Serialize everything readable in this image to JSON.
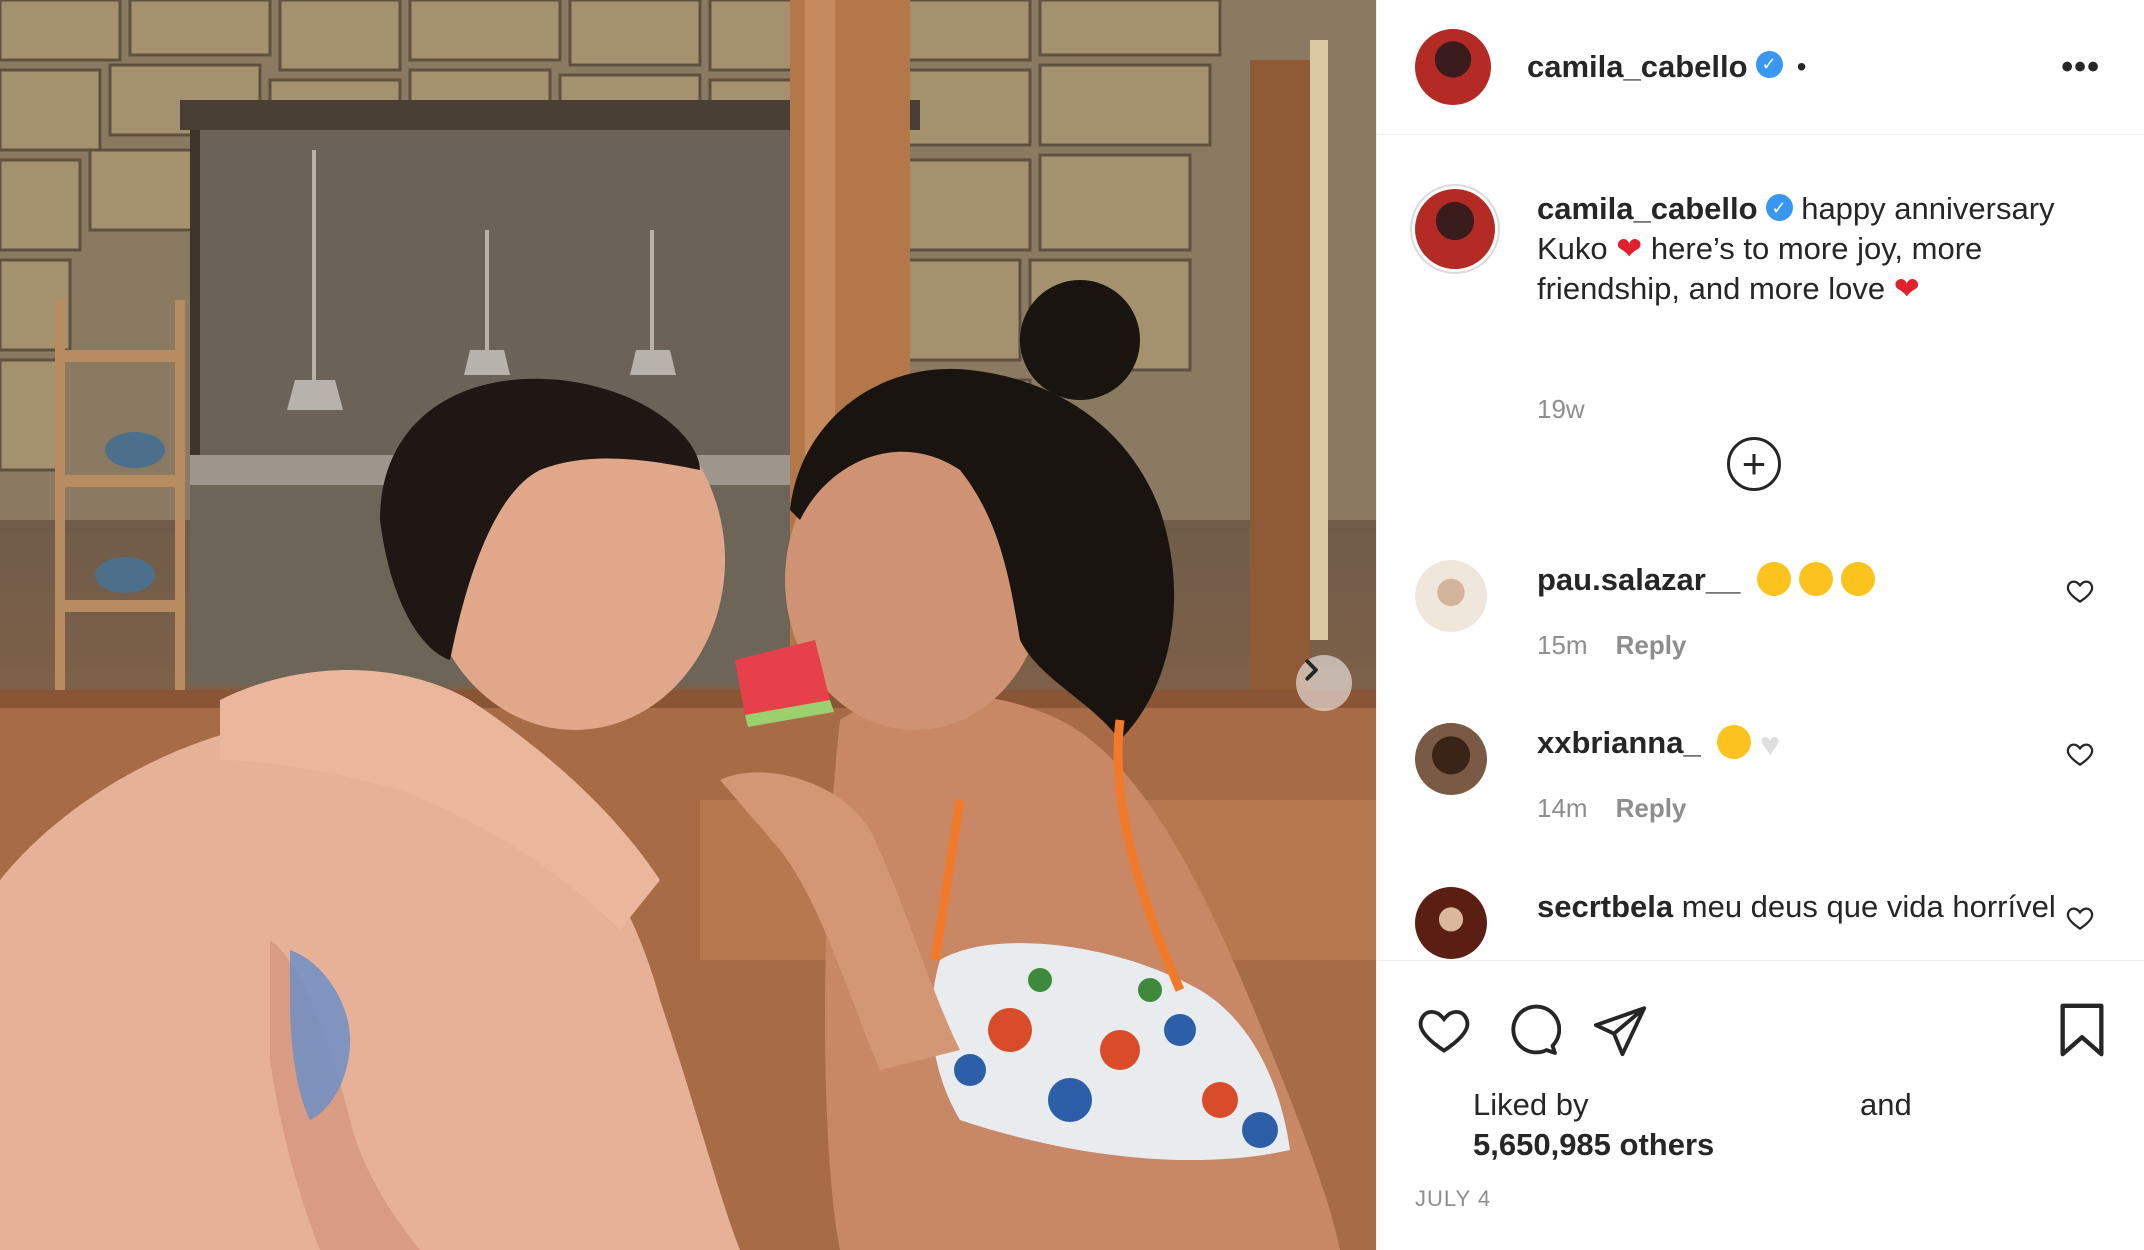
{
  "post": {
    "username": "camila_cabello",
    "header_separator": "•",
    "more_options": "•••"
  },
  "caption": {
    "username": "camila_cabello",
    "text_part1": "happy anniversary Kuko",
    "text_part2": "here’s to more joy, more friendship, and more love",
    "time": "19w"
  },
  "comments": [
    {
      "username": "pau.salazar__",
      "text": "",
      "emojis": [
        "😭",
        "😭",
        "😭"
      ],
      "time": "15m",
      "reply_label": "Reply"
    },
    {
      "username": "xxbrianna_",
      "text": "",
      "emojis": [
        "🥺",
        "🤍"
      ],
      "time": "14m",
      "reply_label": "Reply"
    },
    {
      "username": "secrtbela",
      "text": "meu deus que vida horrível",
      "time": "",
      "reply_label": ""
    }
  ],
  "likes": {
    "liked_by": "Liked by",
    "and": "and",
    "count_text": "5,650,985 others"
  },
  "date": "JULY 4",
  "icons": [
    "heart-icon",
    "comment-icon",
    "share-icon",
    "bookmark-icon",
    "plus-circle-icon",
    "more-options-icon",
    "verified-badge-icon",
    "chevron-right-icon"
  ],
  "colors": {
    "verified": "#3897f0",
    "meta_gray": "#8e8e8e",
    "text": "#262626",
    "heart_red": "#e0202d"
  }
}
